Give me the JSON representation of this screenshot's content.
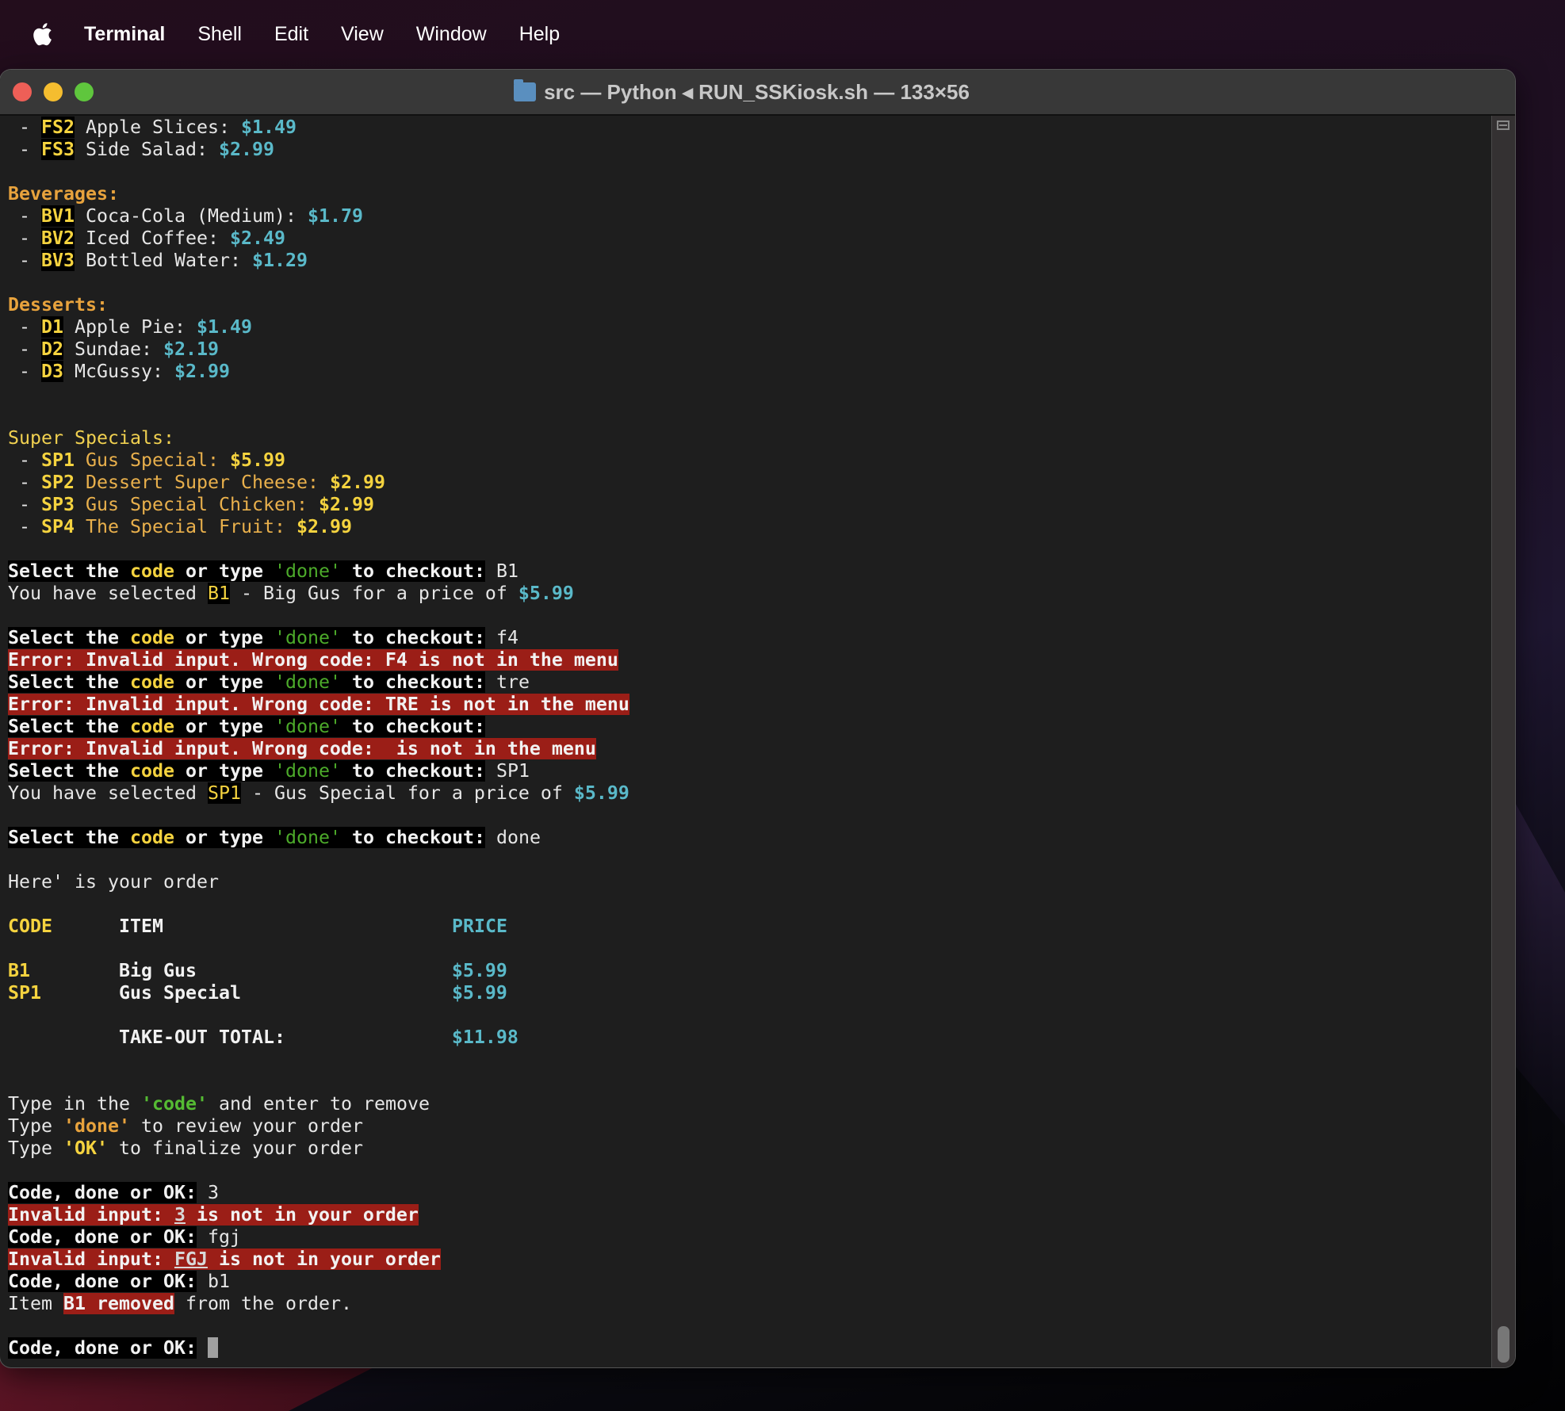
{
  "menubar": {
    "apple": "apple-icon",
    "items": [
      "Terminal",
      "Shell",
      "Edit",
      "View",
      "Window",
      "Help"
    ]
  },
  "window": {
    "title": "src — Python ◂ RUN_SSKiosk.sh — 133×56",
    "lights": {
      "close": "#ee5f57",
      "minimize": "#f5bd2f",
      "zoom": "#5fc63d"
    }
  },
  "lines": [
    [
      [
        " - ",
        "w"
      ],
      [
        "FS2",
        "code"
      ],
      [
        " Apple Slices: ",
        "w"
      ],
      [
        "$1.49",
        "price"
      ]
    ],
    [
      [
        " - ",
        "w"
      ],
      [
        "FS3",
        "code"
      ],
      [
        " Side Salad: ",
        "w"
      ],
      [
        "$2.99",
        "price"
      ]
    ],
    [],
    [
      [
        "Beverages:",
        "hdr"
      ]
    ],
    [
      [
        " - ",
        "w"
      ],
      [
        "BV1",
        "code"
      ],
      [
        " Coca-Cola (Medium): ",
        "w"
      ],
      [
        "$1.79",
        "price"
      ]
    ],
    [
      [
        " - ",
        "w"
      ],
      [
        "BV2",
        "code"
      ],
      [
        " Iced Coffee: ",
        "w"
      ],
      [
        "$2.49",
        "price"
      ]
    ],
    [
      [
        " - ",
        "w"
      ],
      [
        "BV3",
        "code"
      ],
      [
        " Bottled Water: ",
        "w"
      ],
      [
        "$1.29",
        "price"
      ]
    ],
    [],
    [
      [
        "Desserts:",
        "hdr"
      ]
    ],
    [
      [
        " - ",
        "w"
      ],
      [
        "D1",
        "code"
      ],
      [
        " Apple Pie: ",
        "w"
      ],
      [
        "$1.49",
        "price"
      ]
    ],
    [
      [
        " - ",
        "w"
      ],
      [
        "D2",
        "code"
      ],
      [
        " Sundae: ",
        "w"
      ],
      [
        "$2.19",
        "price"
      ]
    ],
    [
      [
        " - ",
        "w"
      ],
      [
        "D3",
        "code"
      ],
      [
        " McGussy: ",
        "w"
      ],
      [
        "$2.99",
        "price"
      ]
    ],
    [],
    [],
    [
      [
        "Super Specials:",
        "ss"
      ]
    ],
    [
      [
        " - ",
        "w"
      ],
      [
        "SP1",
        "yb"
      ],
      [
        " Gus Special: ",
        "spname"
      ],
      [
        "$5.99",
        "yb"
      ]
    ],
    [
      [
        " - ",
        "w"
      ],
      [
        "SP2",
        "yb"
      ],
      [
        " Dessert Super Cheese: ",
        "spname"
      ],
      [
        "$2.99",
        "yb"
      ]
    ],
    [
      [
        " - ",
        "w"
      ],
      [
        "SP3",
        "yb"
      ],
      [
        " Gus Special Chicken: ",
        "spname"
      ],
      [
        "$2.99",
        "yb"
      ]
    ],
    [
      [
        " - ",
        "w"
      ],
      [
        "SP4",
        "yb"
      ],
      [
        " The Special Fruit: ",
        "spname"
      ],
      [
        "$2.99",
        "yb"
      ]
    ],
    [],
    [
      [
        "Select the ",
        "p"
      ],
      [
        "code",
        "pc"
      ],
      [
        " or type ",
        "p"
      ],
      [
        "'done'",
        "pd"
      ],
      [
        " to checkout:",
        "p"
      ],
      [
        " B1",
        "w"
      ]
    ],
    [
      [
        "You have selected ",
        "w"
      ],
      [
        "B1",
        "codereg"
      ],
      [
        " - Big Gus for a price of ",
        "w"
      ],
      [
        "$5.99",
        "price"
      ]
    ],
    [],
    [
      [
        "Select the ",
        "p"
      ],
      [
        "code",
        "pc"
      ],
      [
        " or type ",
        "p"
      ],
      [
        "'done'",
        "pd"
      ],
      [
        " to checkout:",
        "p"
      ],
      [
        " f4",
        "w"
      ]
    ],
    [
      [
        "Error: Invalid input. Wrong code: F4 is not in the menu",
        "err"
      ]
    ],
    [
      [
        "Select the ",
        "p"
      ],
      [
        "code",
        "pc"
      ],
      [
        " or type ",
        "p"
      ],
      [
        "'done'",
        "pd"
      ],
      [
        " to checkout:",
        "p"
      ],
      [
        " tre",
        "w"
      ]
    ],
    [
      [
        "Error: Invalid input. Wrong code: TRE is not in the menu",
        "err"
      ]
    ],
    [
      [
        "Select the ",
        "p"
      ],
      [
        "code",
        "pc"
      ],
      [
        " or type ",
        "p"
      ],
      [
        "'done'",
        "pd"
      ],
      [
        " to checkout:",
        "p"
      ]
    ],
    [
      [
        "Error: Invalid input. Wrong code:  is not in the menu",
        "err"
      ]
    ],
    [
      [
        "Select the ",
        "p"
      ],
      [
        "code",
        "pc"
      ],
      [
        " or type ",
        "p"
      ],
      [
        "'done'",
        "pd"
      ],
      [
        " to checkout:",
        "p"
      ],
      [
        " SP1",
        "w"
      ]
    ],
    [
      [
        "You have selected ",
        "w"
      ],
      [
        "SP1",
        "codereg"
      ],
      [
        " - Gus Special for a price of ",
        "w"
      ],
      [
        "$5.99",
        "price"
      ]
    ],
    [],
    [
      [
        "Select the ",
        "p"
      ],
      [
        "code",
        "pc"
      ],
      [
        " or type ",
        "p"
      ],
      [
        "'done'",
        "pd"
      ],
      [
        " to checkout:",
        "p"
      ],
      [
        " done",
        "w"
      ]
    ],
    [],
    [
      [
        "Here' is your order",
        "w"
      ]
    ],
    [],
    [
      [
        "CODE",
        "yb"
      ],
      [
        "      ",
        "w"
      ],
      [
        "ITEM",
        "wb"
      ],
      [
        "                          ",
        "w"
      ],
      [
        "PRICE",
        "price"
      ]
    ],
    [],
    [
      [
        "B1",
        "yb"
      ],
      [
        "        ",
        "w"
      ],
      [
        "Big Gus",
        "wb"
      ],
      [
        "                       ",
        "w"
      ],
      [
        "$5.99",
        "price"
      ]
    ],
    [
      [
        "SP1",
        "yb"
      ],
      [
        "       ",
        "w"
      ],
      [
        "Gus Special",
        "wb"
      ],
      [
        "                   ",
        "w"
      ],
      [
        "$5.99",
        "price"
      ]
    ],
    [],
    [
      [
        "          ",
        "w"
      ],
      [
        "TAKE-OUT TOTAL:",
        "wb"
      ],
      [
        "               ",
        "w"
      ],
      [
        "$11.98",
        "price"
      ]
    ],
    [],
    [],
    [
      [
        "Type in the ",
        "w"
      ],
      [
        "'code'",
        "gb"
      ],
      [
        " and enter to remove",
        "w"
      ]
    ],
    [
      [
        "Type ",
        "w"
      ],
      [
        "'done'",
        "ob"
      ],
      [
        " to review your order",
        "w"
      ]
    ],
    [
      [
        "Type ",
        "w"
      ],
      [
        "'OK'",
        "yb"
      ],
      [
        " to finalize your order",
        "w"
      ]
    ],
    [],
    [
      [
        "Code, done or OK:",
        "p"
      ],
      [
        " 3",
        "w"
      ]
    ],
    [
      [
        "Invalid input: ",
        "err"
      ],
      [
        "3",
        "errul"
      ],
      [
        " is not in your order",
        "err"
      ]
    ],
    [
      [
        "Code, done or OK:",
        "p"
      ],
      [
        " fgj",
        "w"
      ]
    ],
    [
      [
        "Invalid input: ",
        "err"
      ],
      [
        "FGJ",
        "errul"
      ],
      [
        " is not in your order",
        "err"
      ]
    ],
    [
      [
        "Code, done or OK:",
        "p"
      ],
      [
        " b1",
        "w"
      ]
    ],
    [
      [
        "Item ",
        "w"
      ],
      [
        "B1 removed",
        "err"
      ],
      [
        " from the order.",
        "w"
      ]
    ],
    [],
    [
      [
        "Code, done or OK:",
        "p"
      ],
      [
        " ",
        "w"
      ],
      [
        "",
        "cursor"
      ]
    ]
  ]
}
